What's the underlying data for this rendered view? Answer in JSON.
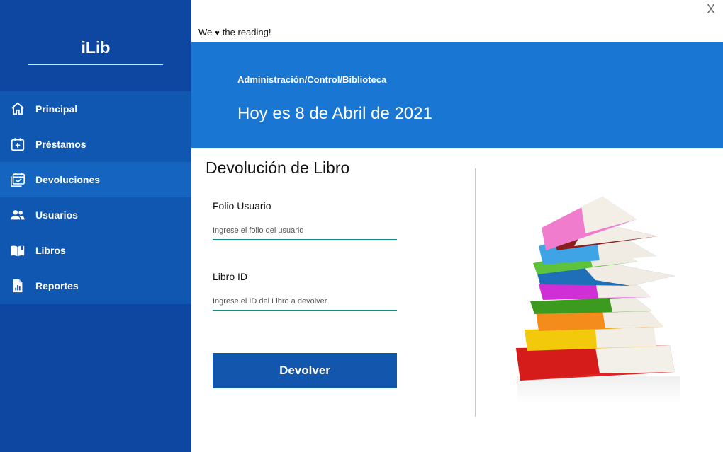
{
  "app": {
    "brand": "iLib",
    "close_label": "X"
  },
  "tagline": {
    "prefix": "We",
    "heart": "♥",
    "suffix": "the reading!"
  },
  "sidebar": {
    "items": [
      {
        "label": "Principal",
        "icon": "home-icon"
      },
      {
        "label": "Préstamos",
        "icon": "calendar-add-icon"
      },
      {
        "label": "Devoluciones",
        "icon": "calendar-check-icon",
        "active": true
      },
      {
        "label": "Usuarios",
        "icon": "users-icon"
      },
      {
        "label": "Libros",
        "icon": "book-open-icon"
      },
      {
        "label": "Reportes",
        "icon": "report-icon"
      }
    ]
  },
  "header": {
    "breadcrumb": "Administración/Control/Biblioteca",
    "date": "Hoy es 8 de Abril de 2021"
  },
  "form": {
    "title": "Devolución de Libro",
    "folio_label": "Folio Usuario",
    "folio_placeholder": "Ingrese el folio del usuario",
    "libro_label": "Libro ID",
    "libro_placeholder": "Ingrese el ID del Libro a devolver",
    "submit_label": "Devolver"
  },
  "colors": {
    "sidebar": "#0d47a1",
    "menu": "#1057b1",
    "menu_active": "#1565c0",
    "banner": "#1976d2",
    "button": "#1257ad",
    "input_underline": "#1b8a8a"
  }
}
